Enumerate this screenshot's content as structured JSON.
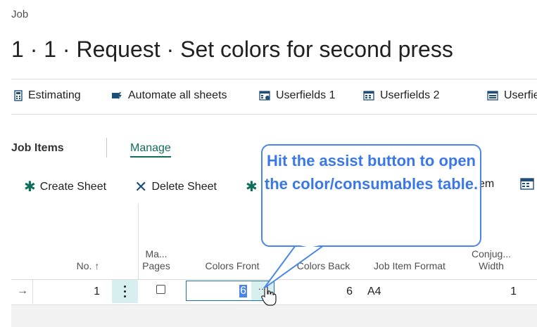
{
  "breadcrumb": "Job",
  "page_title": "1 · 1 · Request · Set colors for second press",
  "toolbar": {
    "items": [
      {
        "label": "Estimating",
        "icon": "calculator-icon"
      },
      {
        "label": "Automate all sheets",
        "icon": "automate-icon"
      },
      {
        "label": "Userfields 1",
        "icon": "userfields-icon"
      },
      {
        "label": "Userfields 2",
        "icon": "userfields-icon"
      },
      {
        "label": "Userfields",
        "icon": "userfields-icon"
      }
    ]
  },
  "job_items": {
    "title": "Job Items",
    "manage_tab": "Manage",
    "actions": [
      {
        "label": "Create Sheet",
        "icon": "create-icon"
      },
      {
        "label": "Delete Sheet",
        "icon": "delete-icon"
      },
      {
        "label": "",
        "icon": "create-icon"
      },
      {
        "label": "em",
        "icon": ""
      },
      {
        "label": "",
        "icon": "table-icon"
      }
    ]
  },
  "columns": {
    "no": "No.",
    "sort_indicator": "↑",
    "ma_pages_1": "Ma...",
    "ma_pages_2": "Pages",
    "colors_front": "Colors Front",
    "colors_back": "Colors Back",
    "job_item_format": "Job Item Format",
    "conjug_1": "Conjug...",
    "conjug_2": "Width"
  },
  "row": {
    "arrow": "→",
    "no": "1",
    "colors_front": "6",
    "colors_back": "6",
    "job_item_format": "A4",
    "conjug_width": "1"
  },
  "callout_text": "Hit the assist button to open the color/consumables table.",
  "colors": {
    "accent": "#0f6e5a",
    "callout": "#4a86e8",
    "selection": "#d8efef"
  }
}
